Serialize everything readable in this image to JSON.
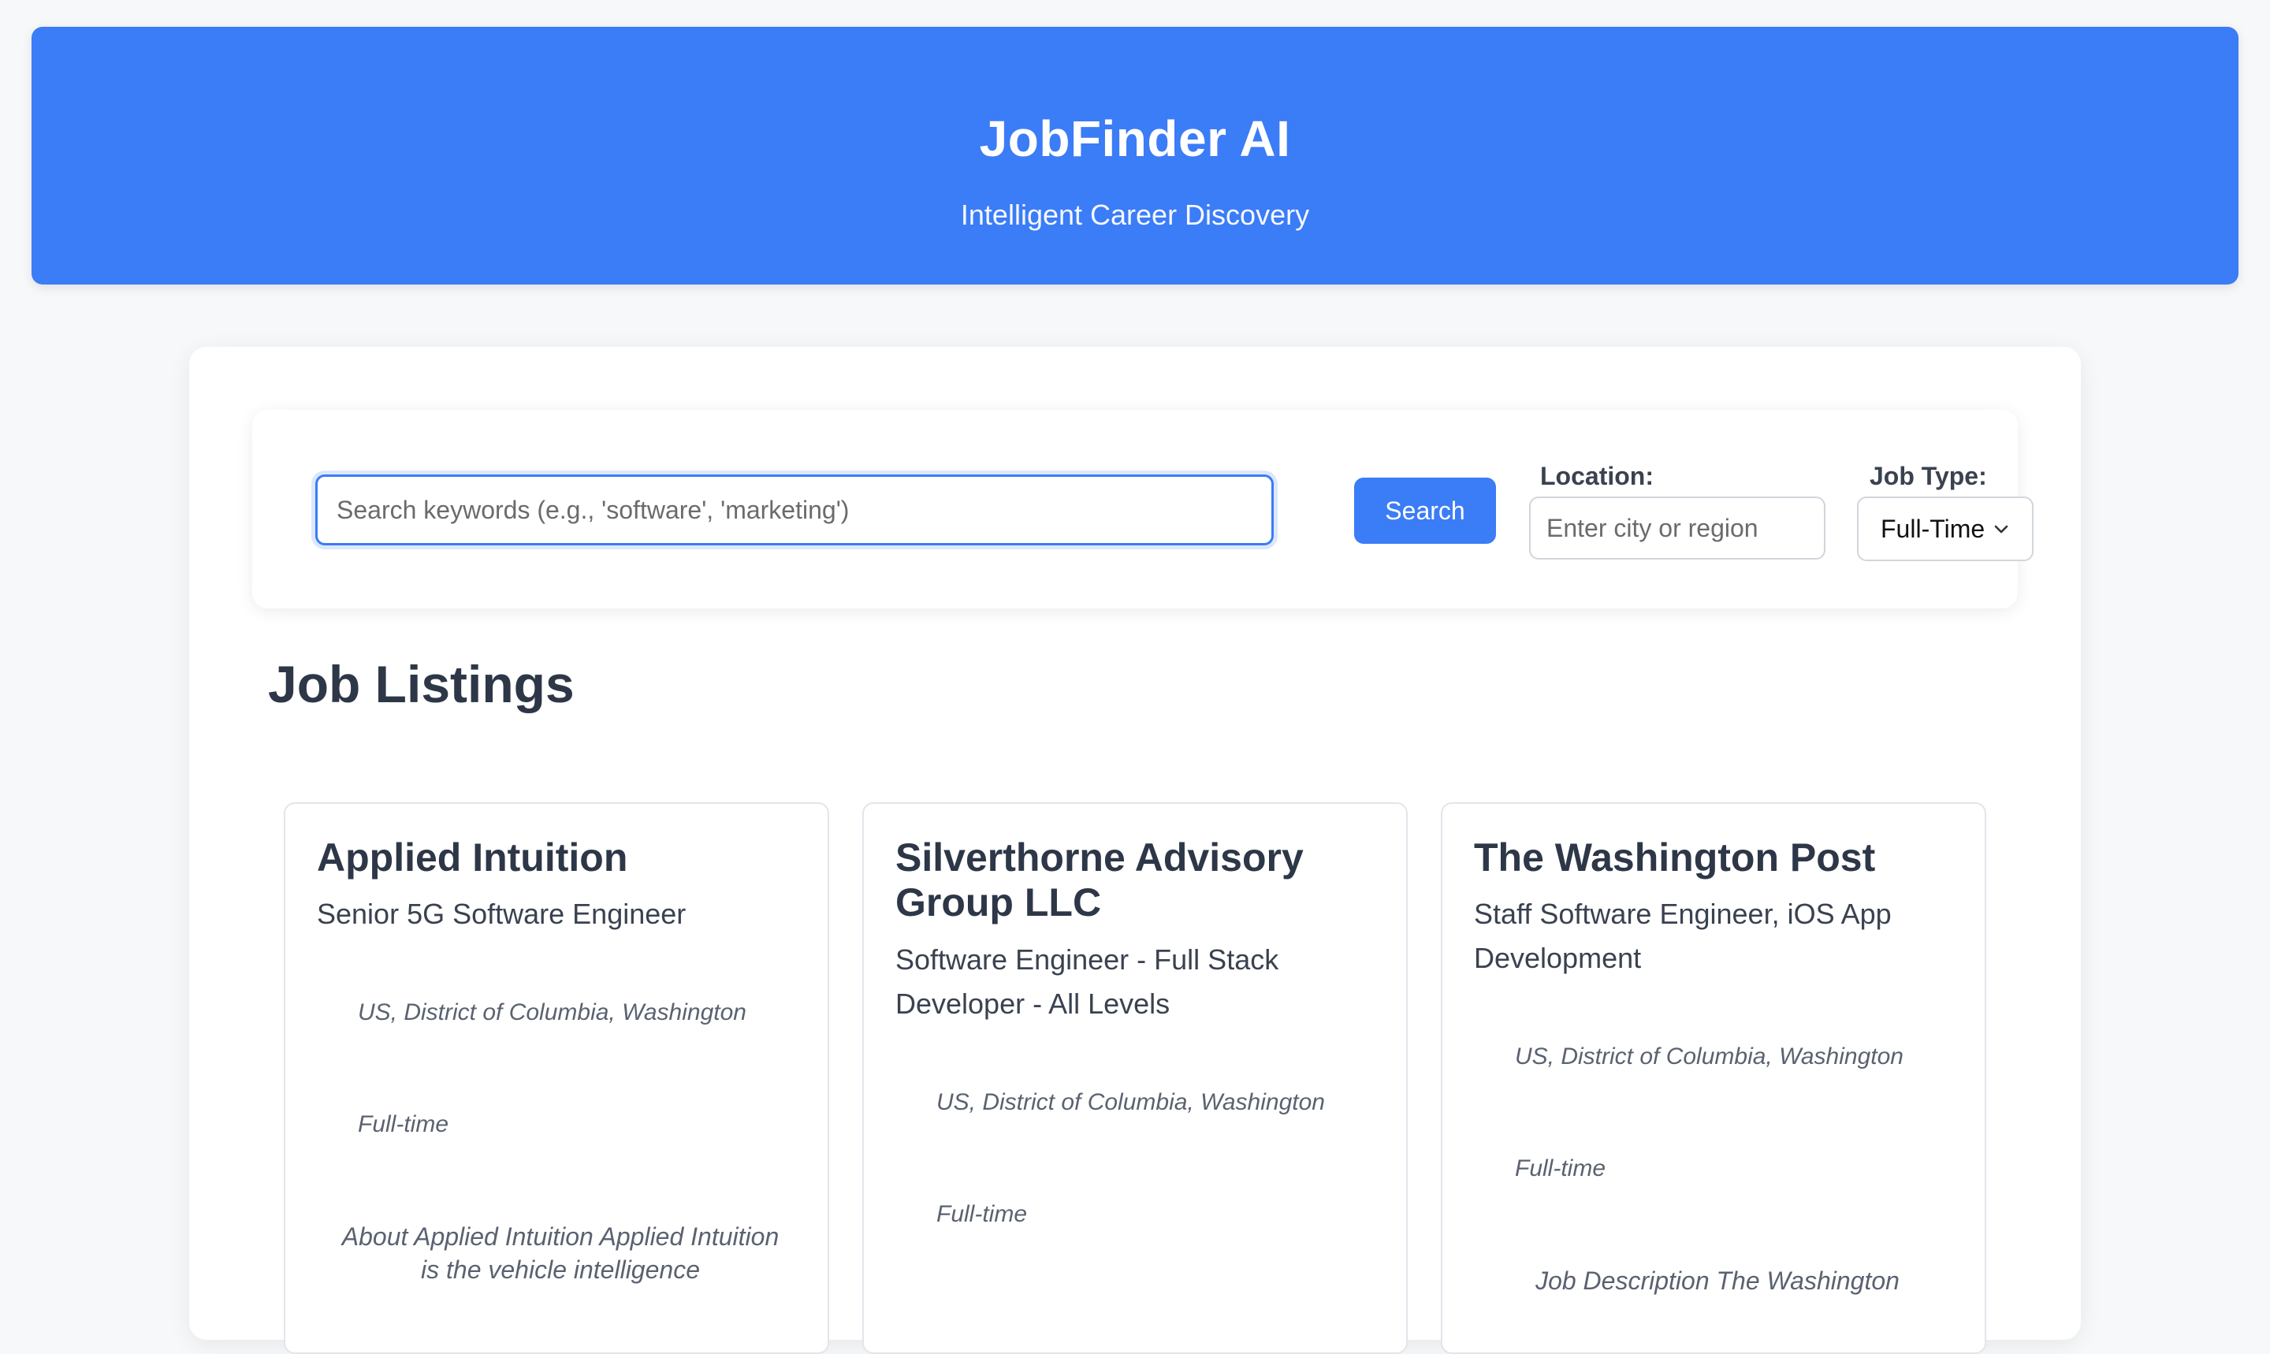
{
  "header": {
    "title": "JobFinder AI",
    "subtitle": "Intelligent Career Discovery"
  },
  "search": {
    "placeholder": "Search keywords (e.g., 'software', 'marketing')",
    "value": "",
    "button_label": "Search",
    "location_label": "Location:",
    "location_placeholder": "Enter city or region",
    "job_type_label": "Job Type:",
    "job_type_selected": "Full-Time"
  },
  "listings": {
    "title": "Job Listings",
    "jobs": [
      {
        "company": "Applied Intuition",
        "role": "Senior 5G Software Engineer",
        "location": "US, District of Columbia, Washington",
        "type": "Full-time",
        "description": "About Applied Intuition Applied Intuition is the vehicle intelligence"
      },
      {
        "company": "Silverthorne Advisory Group LLC",
        "role": "Software Engineer - Full Stack Developer - All Levels",
        "location": "US, District of Columbia, Washington",
        "type": "Full-time",
        "description": ""
      },
      {
        "company": "The Washington Post",
        "role": "Staff Software Engineer, iOS App Development",
        "location": "US, District of Columbia, Washington",
        "type": "Full-time",
        "description": "Job Description The Washington"
      }
    ]
  },
  "colors": {
    "accent": "#3b7cf7",
    "page_bg": "#f6f8fa",
    "text_dark": "#2d3748",
    "text_muted": "#5a6270"
  }
}
